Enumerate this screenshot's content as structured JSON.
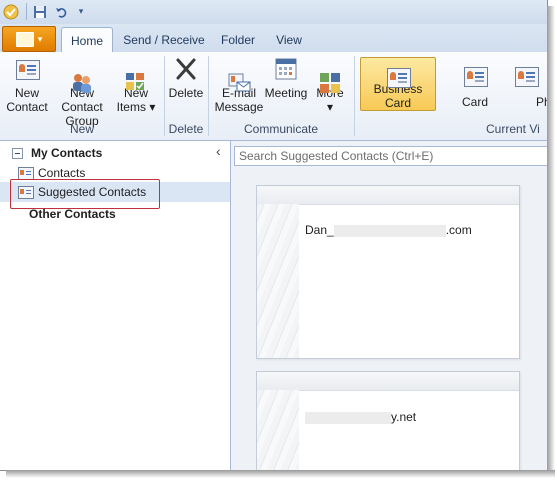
{
  "qat": {
    "icons": [
      "outlook-app-icon",
      "save-icon",
      "undo-icon",
      "customize-qat-icon"
    ]
  },
  "tabs": [
    {
      "label": "Home",
      "active": true
    },
    {
      "label": "Send / Receive",
      "active": false
    },
    {
      "label": "Folder",
      "active": false
    },
    {
      "label": "View",
      "active": false
    }
  ],
  "ribbon": {
    "new_group": {
      "label": "New",
      "new_contact": "New\nContact",
      "new_contact_group": "New Contact\nGroup",
      "new_items": "New\nItems ▾"
    },
    "delete_group": {
      "label": "Delete",
      "delete": "Delete"
    },
    "communicate_group": {
      "label": "Communicate",
      "email_message": "E-mail\nMessage",
      "meeting": "Meeting",
      "more": "More\n▾"
    },
    "current_view_group": {
      "label": "Current Vi",
      "business_card": "Business Card",
      "card": "Card",
      "phone": "Ph"
    }
  },
  "nav": {
    "collapse_icon": "‹",
    "my_contacts": "My Contacts",
    "contacts": "Contacts",
    "suggested_contacts": "Suggested Contacts",
    "other_contacts": "Other Contacts"
  },
  "search": {
    "placeholder": "Search Suggested Contacts (Ctrl+E)"
  },
  "cards": [
    {
      "email_prefix": "Dan_",
      "email_suffix": ".com"
    },
    {
      "email_prefix": "",
      "email_suffix": "y.net"
    }
  ],
  "colors": {
    "file_tab": "#e07b00",
    "selected_view": "#f8c955",
    "annotation_box": "#c0323a"
  }
}
